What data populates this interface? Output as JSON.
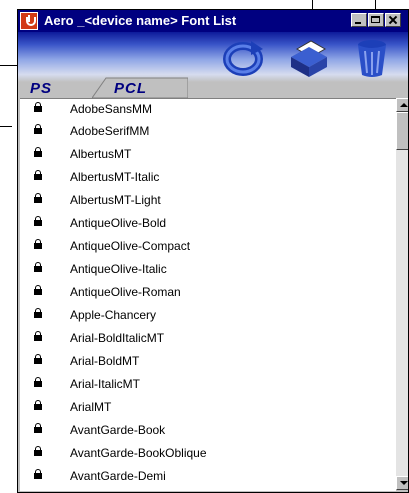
{
  "window": {
    "title": "Aero _<device name> Font List"
  },
  "toolbar": {
    "tools": [
      {
        "icon": "refresh-icon"
      },
      {
        "icon": "printer-icon"
      },
      {
        "icon": "trash-can-icon"
      }
    ]
  },
  "tabs": [
    {
      "label": "PS",
      "active": true
    },
    {
      "label": "PCL",
      "active": false
    }
  ],
  "font_list": {
    "items": [
      {
        "name": "AdobeSansMM"
      },
      {
        "name": "AdobeSerifMM"
      },
      {
        "name": "AlbertusMT"
      },
      {
        "name": "AlbertusMT-Italic"
      },
      {
        "name": "AlbertusMT-Light"
      },
      {
        "name": "AntiqueOlive-Bold"
      },
      {
        "name": "AntiqueOlive-Compact"
      },
      {
        "name": "AntiqueOlive-Italic"
      },
      {
        "name": "AntiqueOlive-Roman"
      },
      {
        "name": "Apple-Chancery"
      },
      {
        "name": "Arial-BoldItalicMT"
      },
      {
        "name": "Arial-BoldMT"
      },
      {
        "name": "Arial-ItalicMT"
      },
      {
        "name": "ArialMT"
      },
      {
        "name": "AvantGarde-Book"
      },
      {
        "name": "AvantGarde-BookOblique"
      },
      {
        "name": "AvantGarde-Demi"
      }
    ]
  },
  "colors": {
    "title_bar": "#000080",
    "tab_text": "#000080",
    "window_face": "#c0c0c0"
  }
}
